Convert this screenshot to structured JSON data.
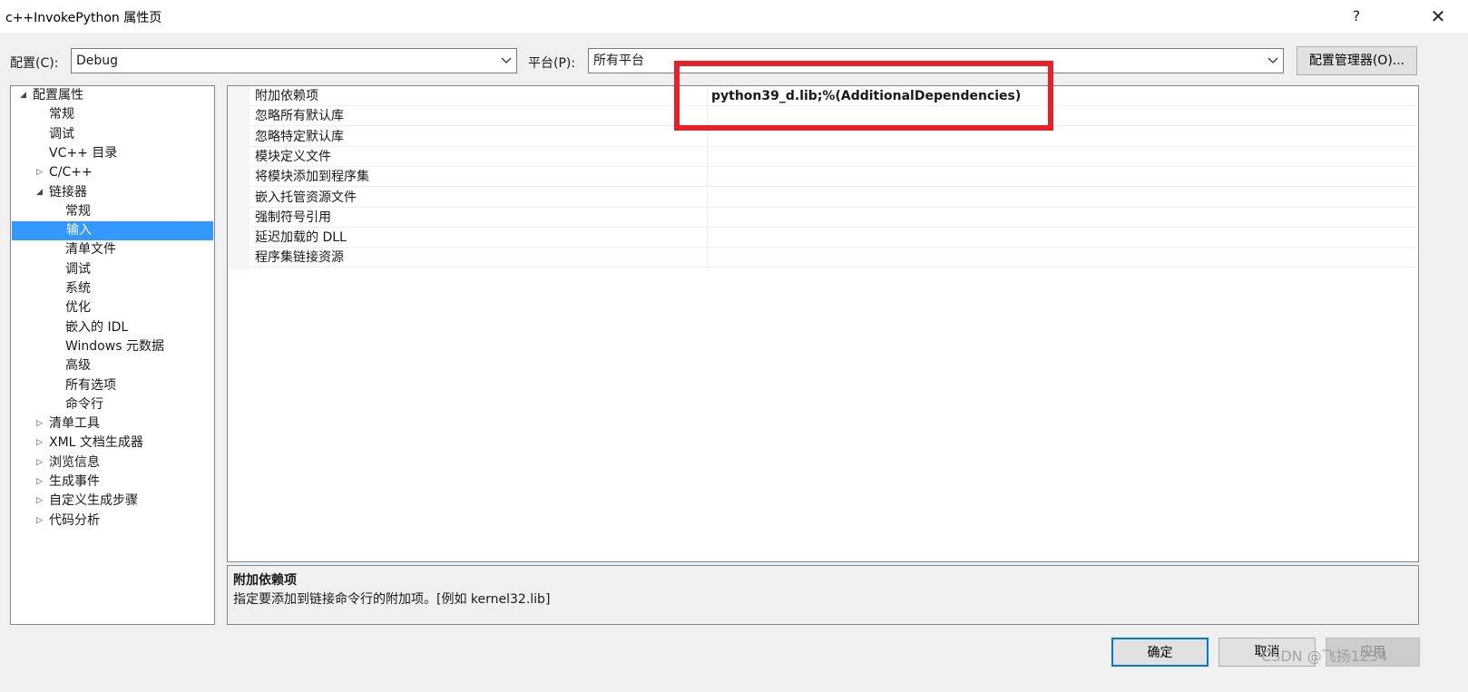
{
  "window": {
    "title": "c++InvokePython 属性页",
    "help_glyph": "?",
    "close_glyph": "✕"
  },
  "toolbar": {
    "config_label": "配置(C):",
    "config_value": "Debug",
    "platform_label": "平台(P):",
    "platform_value": "所有平台",
    "config_manager_label": "配置管理器(O)..."
  },
  "tree": {
    "items": [
      {
        "label": "配置属性",
        "level": 0,
        "expander": "expanded"
      },
      {
        "label": "常规",
        "level": 1,
        "expander": "none"
      },
      {
        "label": "调试",
        "level": 1,
        "expander": "none"
      },
      {
        "label": "VC++ 目录",
        "level": 1,
        "expander": "none"
      },
      {
        "label": "C/C++",
        "level": 1,
        "expander": "collapsed"
      },
      {
        "label": "链接器",
        "level": 1,
        "expander": "expanded"
      },
      {
        "label": "常规",
        "level": 2,
        "expander": "none"
      },
      {
        "label": "输入",
        "level": 2,
        "expander": "none",
        "selected": true
      },
      {
        "label": "清单文件",
        "level": 2,
        "expander": "none"
      },
      {
        "label": "调试",
        "level": 2,
        "expander": "none"
      },
      {
        "label": "系统",
        "level": 2,
        "expander": "none"
      },
      {
        "label": "优化",
        "level": 2,
        "expander": "none"
      },
      {
        "label": "嵌入的 IDL",
        "level": 2,
        "expander": "none"
      },
      {
        "label": "Windows 元数据",
        "level": 2,
        "expander": "none"
      },
      {
        "label": "高级",
        "level": 2,
        "expander": "none"
      },
      {
        "label": "所有选项",
        "level": 2,
        "expander": "none"
      },
      {
        "label": "命令行",
        "level": 2,
        "expander": "none"
      },
      {
        "label": "清单工具",
        "level": 1,
        "expander": "collapsed"
      },
      {
        "label": "XML 文档生成器",
        "level": 1,
        "expander": "collapsed"
      },
      {
        "label": "浏览信息",
        "level": 1,
        "expander": "collapsed"
      },
      {
        "label": "生成事件",
        "level": 1,
        "expander": "collapsed"
      },
      {
        "label": "自定义生成步骤",
        "level": 1,
        "expander": "collapsed"
      },
      {
        "label": "代码分析",
        "level": 1,
        "expander": "collapsed"
      }
    ]
  },
  "grid": {
    "rows": [
      {
        "name": "附加依赖项",
        "value": "python39_d.lib;%(AdditionalDependencies)"
      },
      {
        "name": "忽略所有默认库",
        "value": ""
      },
      {
        "name": "忽略特定默认库",
        "value": ""
      },
      {
        "name": "模块定义文件",
        "value": ""
      },
      {
        "name": "将模块添加到程序集",
        "value": ""
      },
      {
        "name": "嵌入托管资源文件",
        "value": ""
      },
      {
        "name": "强制符号引用",
        "value": ""
      },
      {
        "name": "延迟加载的 DLL",
        "value": ""
      },
      {
        "name": "程序集链接资源",
        "value": ""
      }
    ]
  },
  "description": {
    "title": "附加依赖项",
    "text": "指定要添加到链接命令行的附加项。[例如 kernel32.lib]"
  },
  "buttons": {
    "ok": "确定",
    "cancel": "取消",
    "apply": "应用"
  },
  "watermark": "CSDN @飞扬1234",
  "colors": {
    "selection": "#3399ff",
    "highlight_box": "#e8202a",
    "ok_border": "#0078d7"
  }
}
